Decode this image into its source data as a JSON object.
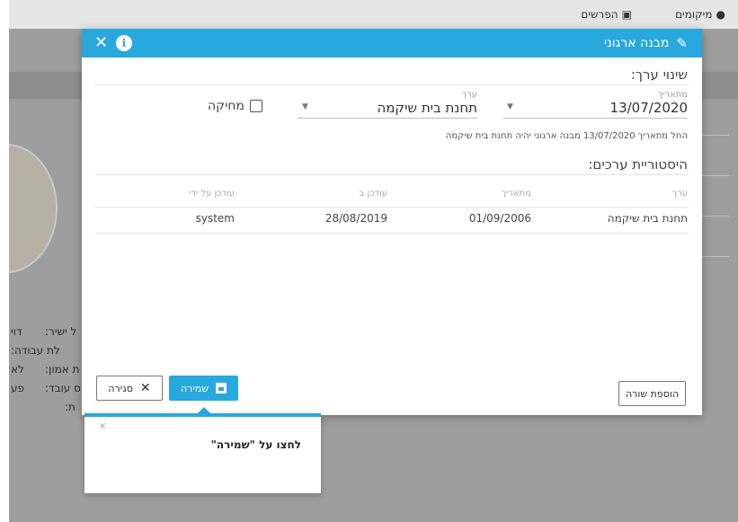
{
  "topbar": {
    "links": [
      {
        "label": "מיקומים",
        "icon": "map-marker-icon"
      },
      {
        "label": "הפרשים",
        "icon": "square-pen-icon"
      }
    ]
  },
  "background": {
    "labels": [
      "ל ישיר:",
      "דוי",
      "לת עבודה:",
      "ת אמון:",
      "לא",
      "וס עובד:",
      "פע",
      "ת:"
    ]
  },
  "modal": {
    "title": "מבנה ארגוני",
    "change_value_title": "שינוי ערך:",
    "date_field": {
      "label": "מתאריך",
      "value": "13/07/2020"
    },
    "value_field": {
      "label": "ערך",
      "value": "תחנת בית שיקמה"
    },
    "delete_label": "מחיקה",
    "note": "החל מתאריך 13/07/2020 מבנה ארגוני יהיה תחנת בית שיקמה",
    "history_title": "היסטוריית ערכים:",
    "history": {
      "columns": [
        "ערך",
        "מתאריך",
        "עודכן ב",
        "עודכן על ידי"
      ],
      "rows": [
        {
          "value": "תחנת בית שיקמה",
          "from_date": "01/09/2006",
          "updated_at": "28/08/2019",
          "updated_by": "system"
        }
      ]
    },
    "buttons": {
      "add_row": "הוספת שורה",
      "save": "שמירה",
      "close": "סגירה"
    }
  },
  "popover": {
    "text": "לחצו על \"שמירה\"",
    "close": "×"
  },
  "colors": {
    "accent": "#29a8dd",
    "overlay": "#9e9e9e"
  }
}
